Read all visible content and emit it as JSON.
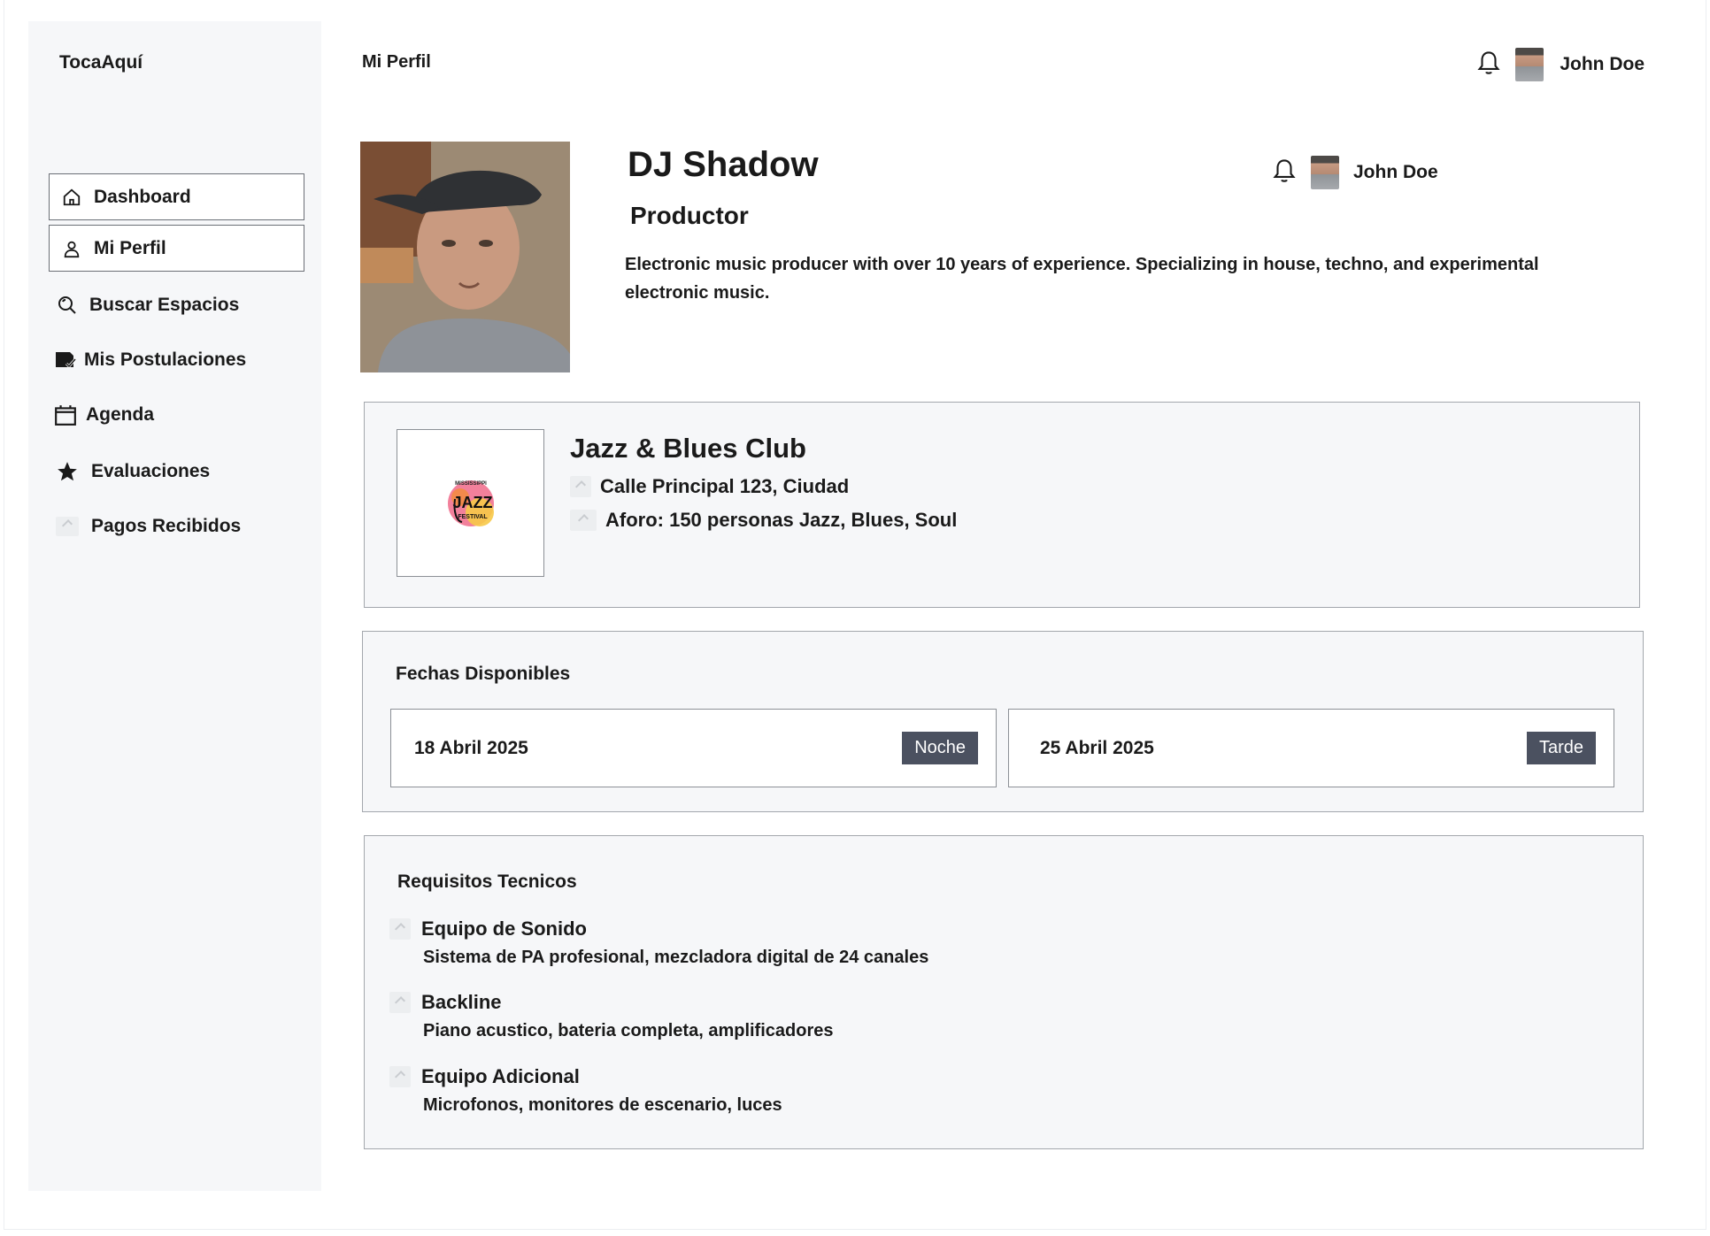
{
  "app": {
    "brand": "TocaAquí"
  },
  "sidebar": {
    "items": [
      {
        "label": "Dashboard",
        "icon": "home-icon"
      },
      {
        "label": "Mi Perfil",
        "icon": "user-icon"
      },
      {
        "label": "Buscar Espacios",
        "icon": "search-icon"
      },
      {
        "label": "Mis Postulaciones",
        "icon": "application-icon"
      },
      {
        "label": "Agenda",
        "icon": "calendar-icon"
      },
      {
        "label": "Evaluaciones",
        "icon": "star-icon"
      },
      {
        "label": "Pagos Recibidos",
        "icon": "broken-image-icon"
      }
    ]
  },
  "header": {
    "title": "Mi Perfil",
    "user_name": "John Doe"
  },
  "profile": {
    "name": "DJ Shadow",
    "role": "Productor",
    "bio": "Electronic music producer with over 10 years of experience. Specializing in house, techno, and experimental electronic music.",
    "user_name": "John Doe"
  },
  "venue": {
    "name": "Jazz & Blues Club",
    "address": "Calle Principal 123, Ciudad",
    "capacity": "Aforo: 150 personas Jazz, Blues, Soul",
    "logo": {
      "top_text": "MISSISSIPPI",
      "big_text": "JAZZ",
      "bottom_text": "FESTIVAL"
    }
  },
  "dates": {
    "title": "Fechas Disponibles",
    "items": [
      {
        "date": "18 Abril 2025",
        "slot": "Noche"
      },
      {
        "date": "25 Abril 2025",
        "slot": "Tarde"
      }
    ]
  },
  "requirements": {
    "title": "Requisitos Tecnicos",
    "items": [
      {
        "name": "Equipo de Sonido",
        "desc": "Sistema de PA profesional, mezcladora digital de 24 canales"
      },
      {
        "name": "Backline",
        "desc": "Piano acustico, bateria completa, amplificadores"
      },
      {
        "name": "Equipo Adicional",
        "desc": "Microfonos, monitores de escenario, luces"
      }
    ]
  },
  "colors": {
    "sidebar_bg": "#f6f7f9",
    "badge_bg": "#4b5160",
    "border": "#a3a7ad"
  }
}
